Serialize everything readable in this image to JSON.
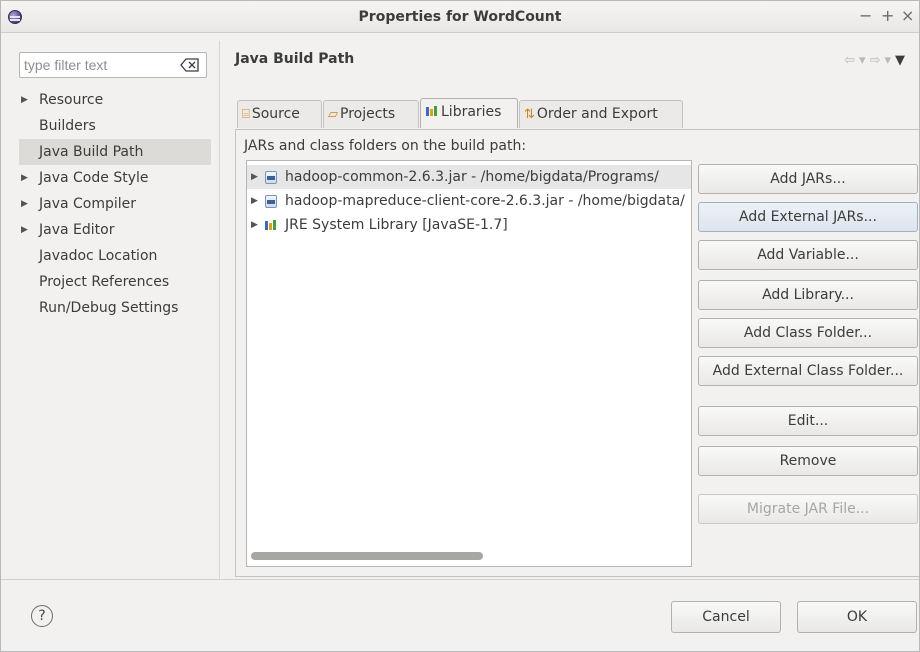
{
  "window": {
    "title": "Properties for WordCount",
    "controls": {
      "minimize": "−",
      "maximize": "+",
      "close": "×"
    }
  },
  "filter": {
    "placeholder": "type filter text"
  },
  "tree": {
    "items": [
      {
        "label": "Resource",
        "expandable": true
      },
      {
        "label": "Builders",
        "expandable": false
      },
      {
        "label": "Java Build Path",
        "expandable": false,
        "selected": true
      },
      {
        "label": "Java Code Style",
        "expandable": true
      },
      {
        "label": "Java Compiler",
        "expandable": true
      },
      {
        "label": "Java Editor",
        "expandable": true
      },
      {
        "label": "Javadoc Location",
        "expandable": false
      },
      {
        "label": "Project References",
        "expandable": false
      },
      {
        "label": "Run/Debug Settings",
        "expandable": false
      }
    ]
  },
  "page": {
    "title": "Java Build Path"
  },
  "tabs": [
    {
      "label": "Source",
      "icon": "source-folder-icon"
    },
    {
      "label": "Projects",
      "icon": "projects-icon"
    },
    {
      "label": "Libraries",
      "icon": "library-icon",
      "active": true
    },
    {
      "label": "Order and Export",
      "icon": "order-export-icon"
    }
  ],
  "libraries": {
    "label": "JARs and class folders on the build path:",
    "items": [
      {
        "text": "hadoop-common-2.6.3.jar - /home/bigdata/Programs/",
        "icon": "jar-icon",
        "selected": true
      },
      {
        "text": "hadoop-mapreduce-client-core-2.6.3.jar - /home/bigdata/",
        "icon": "jar-icon"
      },
      {
        "text": "JRE System Library [JavaSE-1.7]",
        "icon": "library-icon"
      }
    ]
  },
  "buttons": {
    "add_jars": "Add JARs...",
    "add_external_jars": "Add External JARs...",
    "add_variable": "Add Variable...",
    "add_library": "Add Library...",
    "add_class_folder": "Add Class Folder...",
    "add_external_class_folder": "Add External Class Folder...",
    "edit": "Edit...",
    "remove": "Remove",
    "migrate_jar": "Migrate JAR File..."
  },
  "footer": {
    "help": "?",
    "cancel": "Cancel",
    "ok": "OK"
  }
}
